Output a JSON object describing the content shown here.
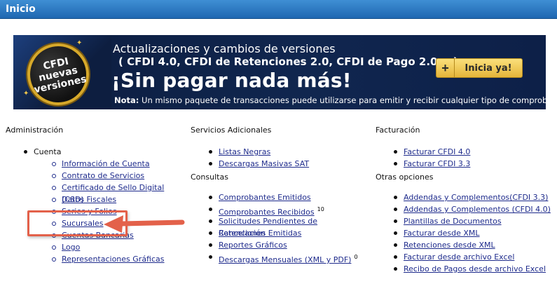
{
  "header": {
    "title": "Inicio"
  },
  "banner": {
    "badge": [
      "CFDI",
      "nuevas",
      "versiones"
    ],
    "line1": "Actualizaciones y cambios de versiones",
    "line2": "( CFDI 4.0, CFDI de Retenciones 2.0, CFDI de Pago 2.0... )",
    "headline": "¡Sin pagar nada más!",
    "note_label": "Nota:",
    "note_text": "Un mismo paquete de transacciones puede utilizarse para emitir y recibir cualquier tipo de comprobante.",
    "cta_plus": "+",
    "cta_label": "Inicia ya!",
    "colors": {
      "cta": "#e5b53a",
      "badge_ring": "#d7a92a",
      "bg": "#10264f"
    }
  },
  "administracion": {
    "title": "Administración",
    "cuenta_label": "Cuenta",
    "items": [
      "Información de Cuenta",
      "Contrato de Servicios",
      "Certificado de Sello Digital (CSD)",
      "Datos Fiscales",
      "Series y Folios",
      "Sucursales",
      "Cuentas Bancarias",
      "Logo",
      "Representaciones Gráficas"
    ]
  },
  "servicios": {
    "title": "Servicios Adicionales",
    "items": [
      "Listas Negras",
      "Descargas Masivas SAT"
    ]
  },
  "consultas": {
    "title": "Consultas",
    "items": [
      {
        "label": "Comprobantes Emitidos",
        "badge": ""
      },
      {
        "label": "Comprobantes Recibidos",
        "badge": "10"
      },
      {
        "label": "Solicitudes Pendientes de Cancelación",
        "badge": ""
      },
      {
        "label": "Retenciones Emitidas",
        "badge": ""
      },
      {
        "label": "Reportes Gráficos",
        "badge": ""
      },
      {
        "label": "Descargas Mensuales (XML y PDF)",
        "badge": "0"
      }
    ]
  },
  "facturacion": {
    "title": "Facturación",
    "items": [
      "Facturar CFDI 4.0",
      "Facturar CFDI 3.3"
    ]
  },
  "otras": {
    "title": "Otras opciones",
    "items": [
      "Addendas y Complementos(CFDI 3.3)",
      "Addendas y Complementos (CFDI 4.0)",
      "Plantillas de Documentos",
      "Facturar desde XML",
      "Retenciones desde XML",
      "Facturar desde archivo Excel",
      "Recibo de Pagos desde archivo Excel"
    ]
  },
  "annotation": {
    "color": "#e3614a",
    "icon": "arrow-left-icon"
  }
}
